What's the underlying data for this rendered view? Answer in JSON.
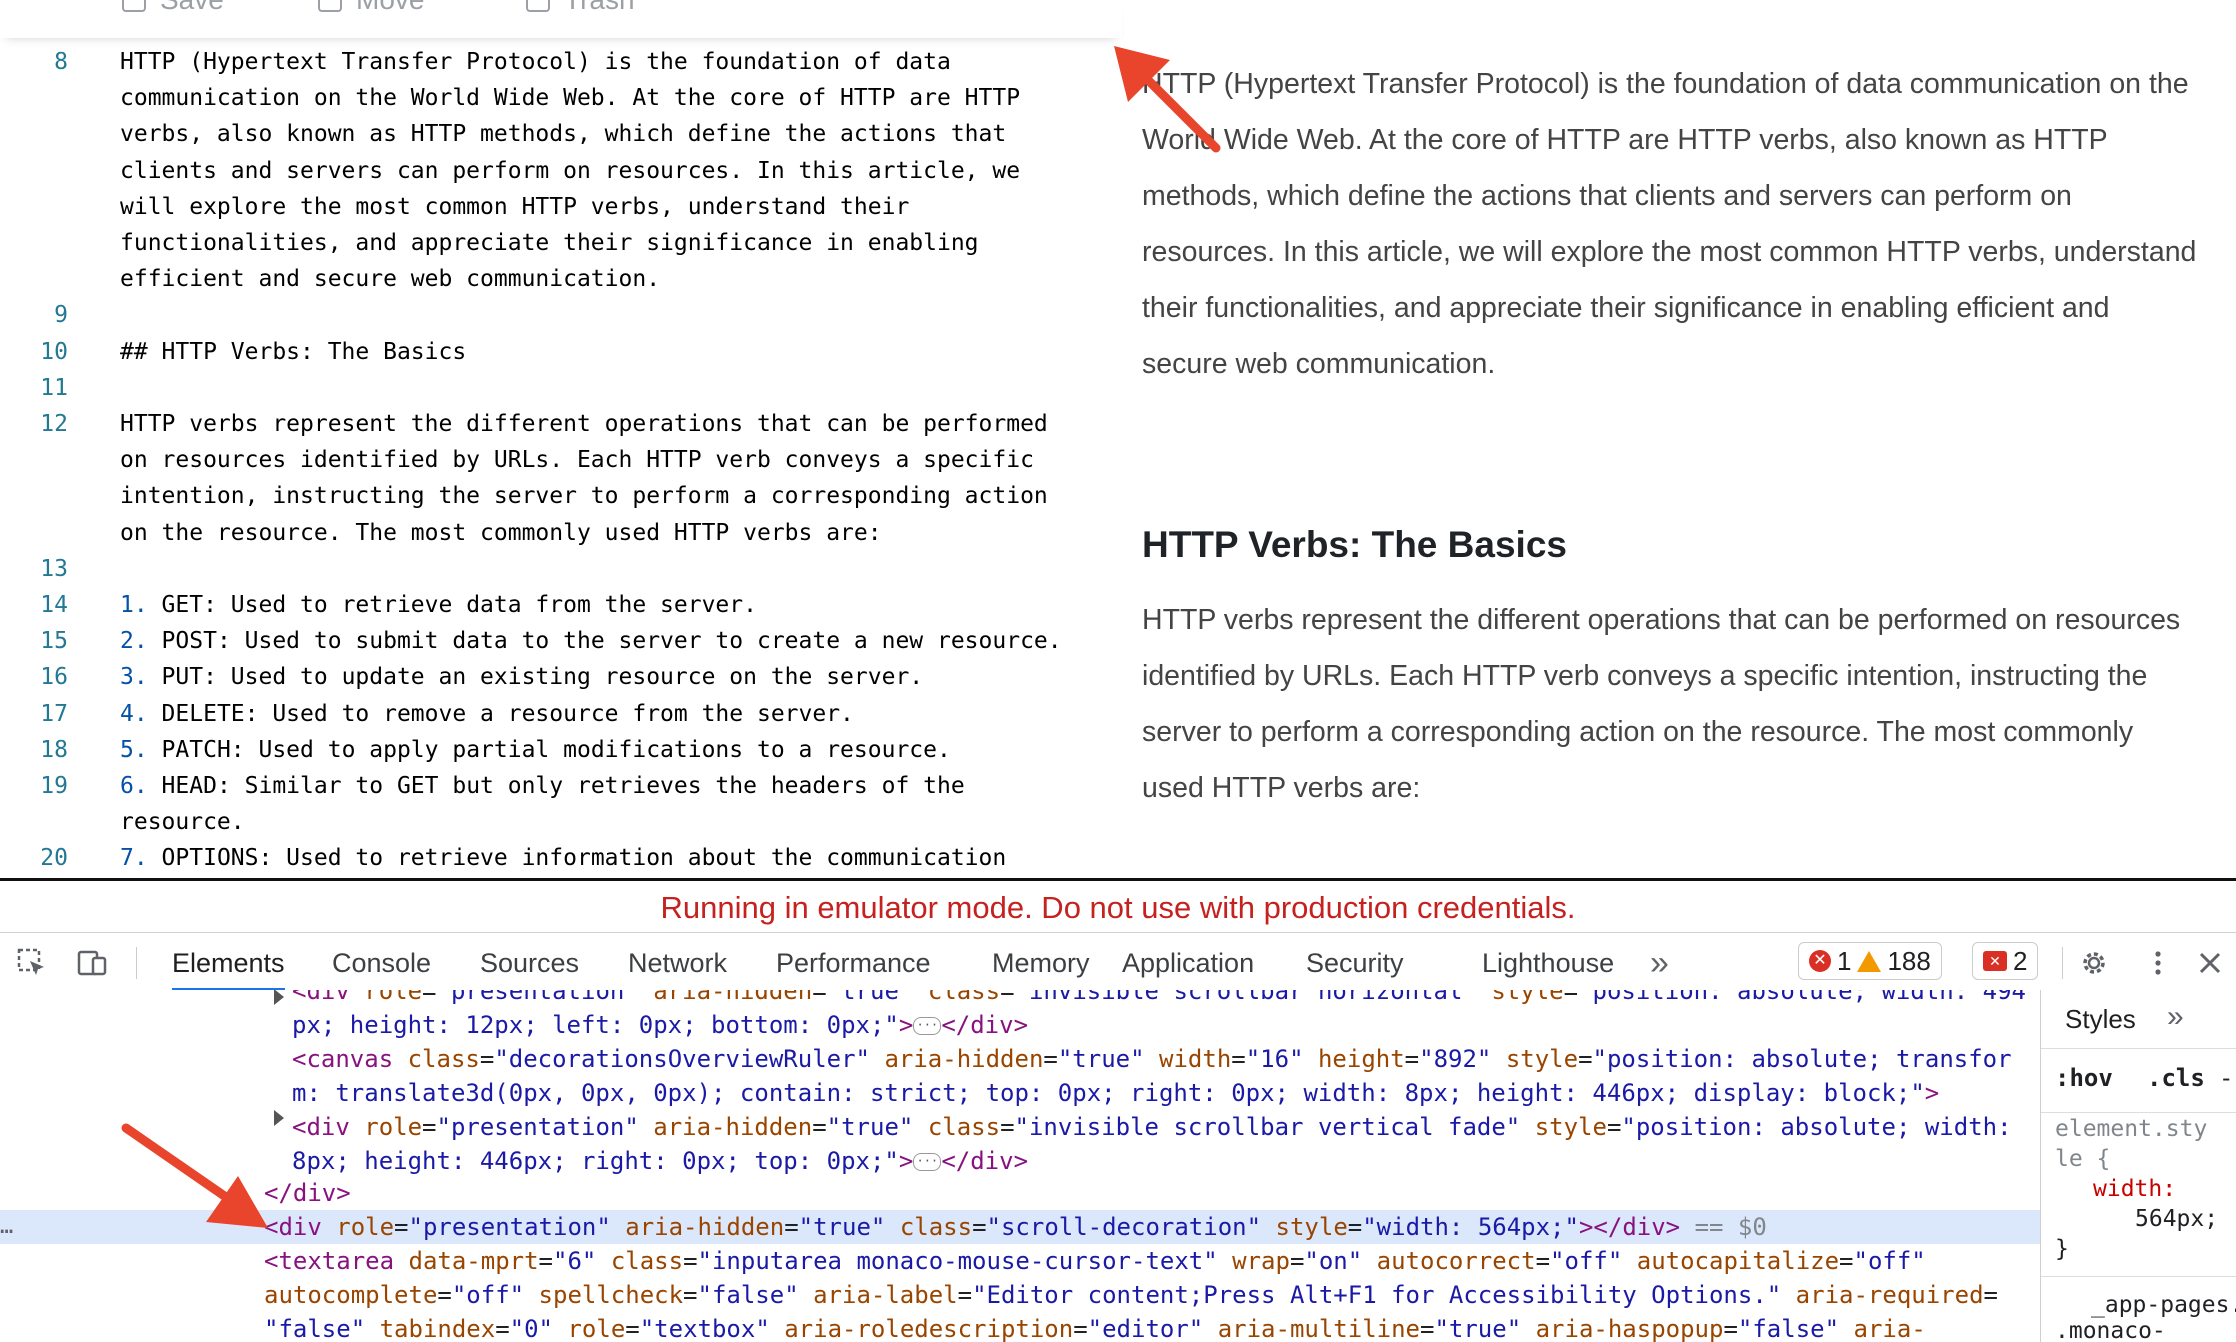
{
  "toolbar": {
    "buttons": [
      {
        "label": "Save",
        "icon": "save-icon"
      },
      {
        "label": "Move",
        "icon": "move-icon"
      },
      {
        "label": "Trash",
        "icon": "trash-icon"
      }
    ]
  },
  "editor": {
    "lines": [
      {
        "n": "8",
        "t": "HTTP (Hypertext Transfer Protocol) is the foundation of data"
      },
      {
        "n": "",
        "t": "communication on the World Wide Web. At the core of HTTP are HTTP"
      },
      {
        "n": "",
        "t": "verbs, also known as HTTP methods, which define the actions that"
      },
      {
        "n": "",
        "t": "clients and servers can perform on resources. In this article, we"
      },
      {
        "n": "",
        "t": "will explore the most common HTTP verbs, understand their"
      },
      {
        "n": "",
        "t": "functionalities, and appreciate their significance in enabling"
      },
      {
        "n": "",
        "t": "efficient and secure web communication."
      },
      {
        "n": "9",
        "t": ""
      },
      {
        "n": "10",
        "t": "## HTTP Verbs: The Basics"
      },
      {
        "n": "11",
        "t": ""
      },
      {
        "n": "12",
        "t": "HTTP verbs represent the different operations that can be performed"
      },
      {
        "n": "",
        "t": "on resources identified by URLs. Each HTTP verb conveys a specific"
      },
      {
        "n": "",
        "t": "intention, instructing the server to perform a corresponding action"
      },
      {
        "n": "",
        "t": "on the resource. The most commonly used HTTP verbs are:"
      },
      {
        "n": "13",
        "t": ""
      },
      {
        "n": "14",
        "m": "1.",
        "t": " GET: Used to retrieve data from the server."
      },
      {
        "n": "15",
        "m": "2.",
        "t": " POST: Used to submit data to the server to create a new resource."
      },
      {
        "n": "16",
        "m": "3.",
        "t": " PUT: Used to update an existing resource on the server."
      },
      {
        "n": "17",
        "m": "4.",
        "t": " DELETE: Used to remove a resource from the server."
      },
      {
        "n": "18",
        "m": "5.",
        "t": " PATCH: Used to apply partial modifications to a resource."
      },
      {
        "n": "19",
        "m": "6.",
        "t": " HEAD: Similar to GET but only retrieves the headers of the"
      },
      {
        "n": "",
        "t": "resource."
      },
      {
        "n": "20",
        "m": "7.",
        "t": " OPTIONS: Used to retrieve information about the communication"
      }
    ]
  },
  "preview": {
    "para1": [
      "HTTP (Hypertext Transfer Protocol) is the foundation of data communication on the",
      "World Wide Web. At the core of HTTP are HTTP verbs, also known as HTTP",
      "methods, which define the actions that clients and servers can perform on",
      "resources. In this article, we will explore the most common HTTP verbs, understand",
      "their functionalities, and appreciate their significance in enabling efficient and",
      "secure web communication."
    ],
    "heading": "HTTP Verbs: The Basics",
    "para2": [
      "HTTP verbs represent the different operations that can be performed on resources",
      "identified by URLs. Each HTTP verb conveys a specific intention, instructing the",
      "server to perform a corresponding action on the resource. The most commonly",
      "used HTTP verbs are:"
    ]
  },
  "banner": {
    "text": "Running in emulator mode. Do not use with production credentials."
  },
  "devtools": {
    "tabs": [
      "Elements",
      "Console",
      "Sources",
      "Network",
      "Performance",
      "Memory",
      "Application",
      "Security",
      "Lighthouse"
    ],
    "more_tabs": "»",
    "errors": "1",
    "warnings": "188",
    "issues": "2",
    "selected_suffix": "== $0"
  },
  "styles": {
    "title": "Styles",
    "more": "»",
    "filter_hov": ":hov",
    "filter_cls": ".cls",
    "element_style": "element.sty\nle {",
    "prop": "width:",
    "value": "564px;",
    "close": "}",
    "next_rule": "_app-pages.",
    "next_rule2": ".monaco-"
  },
  "colors": {
    "arrow": "#e8452c",
    "selection": "#dbe7fb",
    "link": "#0000ff",
    "error": "#c5221f",
    "accent": "#1a73e8"
  }
}
